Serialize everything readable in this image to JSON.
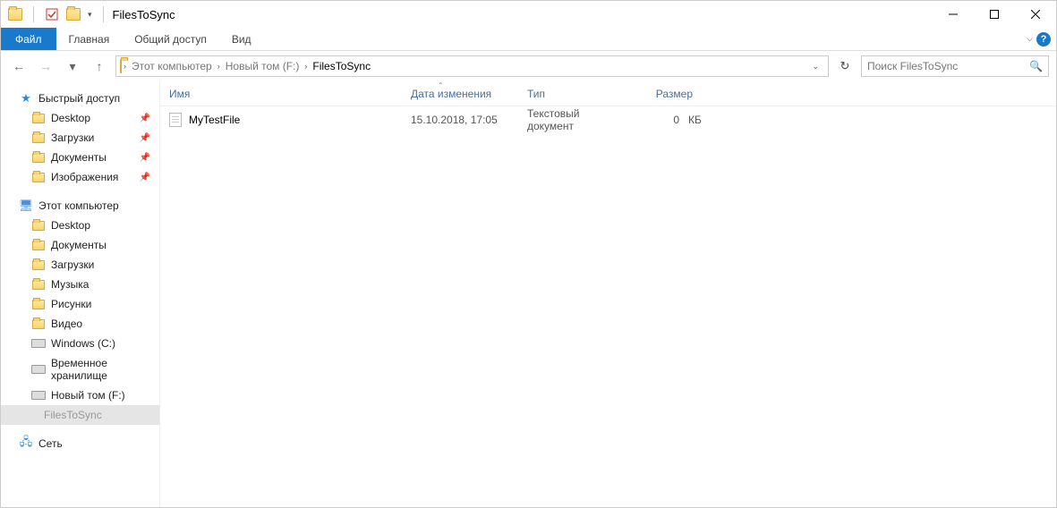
{
  "titlebar": {
    "title": "FilesToSync"
  },
  "ribbon": {
    "file": "Файл",
    "tabs": [
      "Главная",
      "Общий доступ",
      "Вид"
    ]
  },
  "address": {
    "crumbs": [
      "Этот компьютер",
      "Новый том (F:)",
      "FilesToSync"
    ]
  },
  "search": {
    "placeholder": "Поиск FilesToSync"
  },
  "nav": {
    "quick": {
      "label": "Быстрый доступ",
      "items": [
        "Desktop",
        "Загрузки",
        "Документы",
        "Изображения"
      ]
    },
    "pc": {
      "label": "Этот компьютер",
      "items": [
        "Desktop",
        "Документы",
        "Загрузки",
        "Музыка",
        "Рисунки",
        "Видео",
        "Windows (C:)",
        "Временное хранилище",
        "Новый том (F:)",
        "FilesToSync"
      ]
    },
    "network": {
      "label": "Сеть"
    }
  },
  "columns": {
    "name": "Имя",
    "date": "Дата изменения",
    "type": "Тип",
    "size": "Размер"
  },
  "files": [
    {
      "name": "MyTestFile",
      "date": "15.10.2018, 17:05",
      "type": "Текстовый документ",
      "size": "0",
      "unit": "КБ"
    }
  ]
}
